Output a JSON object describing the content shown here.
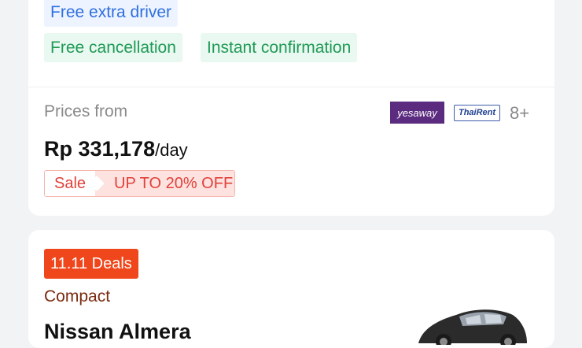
{
  "listing1": {
    "tags": {
      "extra_driver": "Free extra driver",
      "cancellation": "Free cancellation",
      "confirmation": "Instant confirmation"
    },
    "prices_from_label": "Prices from",
    "price": "Rp 331,178",
    "price_unit": "/day",
    "sale_label": "Sale",
    "sale_offer": "UP TO 20% OFF",
    "suppliers": {
      "yesaway_logo_text": "yesaway",
      "thairent_logo_text": "ThaiRent",
      "more_count": "8+"
    }
  },
  "listing2": {
    "deal_badge": "11.11 Deals",
    "category": "Compact",
    "car_name": "Nissan Almera"
  },
  "colors": {
    "page_bg": "#f2f3f5",
    "card_bg": "#ffffff",
    "tag_blue_bg": "#eef4ff",
    "tag_blue_text": "#2f6fe0",
    "tag_green_bg": "#e9f8f0",
    "tag_green_text": "#1f9a56",
    "sale_red": "#e2403a",
    "deal_orange": "#f0461b",
    "yesaway_purple": "#5b2b7f"
  },
  "icons": {
    "car": "car-photo-icon"
  }
}
